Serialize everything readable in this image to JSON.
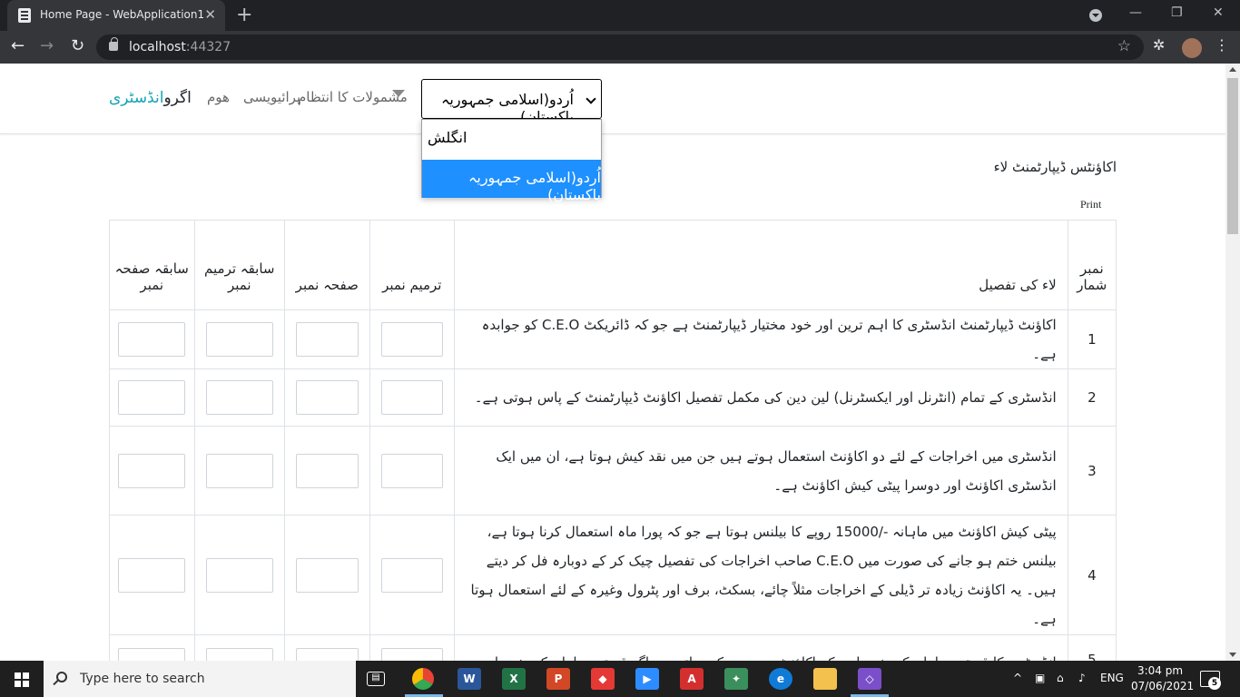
{
  "browser": {
    "tab_title": "Home Page - WebApplication1",
    "tab_close": "✕",
    "new_tab": "+",
    "url_host": "localhost",
    "url_port": ":44327",
    "minimize": "—",
    "maximize": "❐",
    "close": "✕"
  },
  "nav": {
    "brand_plain": "اگرو",
    "brand_accent": "انڈسٹری",
    "home": "ھوم",
    "privacy": "پرائیویسی",
    "management": "مشمولات کا انتظام"
  },
  "language": {
    "selected": "اُردو(اسلامی جمہوریہ پاکستان)",
    "options": [
      "انگلش",
      "اُردو(اسلامی جمہوریہ پاکستان)"
    ]
  },
  "page": {
    "heading": "اکاؤنٹس ڈیپارٹمنٹ لاء",
    "print": "Print"
  },
  "table": {
    "headers": {
      "serial_line1": "نمبر",
      "serial_line2": "شمار",
      "description": "لاء کی تفصیل",
      "amendment": "ترمیم نمبر",
      "page_no": "صفحہ نمبر",
      "prev_amendment_line1": "سابقہ ترمیم",
      "prev_amendment_line2": "نمبر",
      "prev_page_line1": "سابقہ صفحہ",
      "prev_page_line2": "نمبر"
    },
    "rows": [
      {
        "num": "1",
        "text": "اکاؤنٹ ڈیپارٹمنٹ انڈسٹری کا اہم ترین اور خود مختیار ڈیپارٹمنٹ ہے جو کہ ڈائریکٹ C.E.O کو جوابدہ ہے۔"
      },
      {
        "num": "2",
        "text": "انڈسٹری کے تمام (انٹرنل اور ایکسٹرنل) لین دین کی مکمل تفصیل اکاؤنٹ ڈیپارٹمنٹ کے پاس ہوتی ہے۔"
      },
      {
        "num": "3",
        "text": "انڈسٹری میں اخراجات کے لئے دو اکاؤنٹ استعمال ہوتے ہیں جن میں نقد کیش ہوتا ہے، ان میں ایک انڈسٹری اکاؤنٹ اور دوسرا پیٹی کیش اکاؤنٹ ہے۔"
      },
      {
        "num": "4",
        "text": "پیٹی کیش اکاؤنٹ میں ماہانہ -/15000 روپے کا بیلنس ہوتا ہے جو کہ پورا ماہ استعمال کرنا ہوتا ہے، بیلنس ختم ہو جانے کی صورت میں C.E.O صاحب اخراجات کی تفصیل چیک کر کے دوبارہ فل کر دیتے ہیں۔ یہ اکاؤنٹ زیادہ تر ڈیلی کے اخراجات مثلاً چائے، بسکٹ، برف اور پٹرول وغیرہ کے لئے استعمال ہوتا ہے۔"
      },
      {
        "num": "5",
        "text": "انڈسٹری کا قیمتی سامان کی خریداری کے اکاؤنٹ میں سے کی جاتی ہے اگر قیمتی سامان کی خریداری کی لاگت زیادہ ہو تو اکاؤنٹ انڈسٹری کی"
      }
    ]
  },
  "taskbar": {
    "search_placeholder": "Type here to search",
    "lang": "ENG",
    "time": "3:04 pm",
    "date": "07/06/2021",
    "notifications": "5"
  }
}
